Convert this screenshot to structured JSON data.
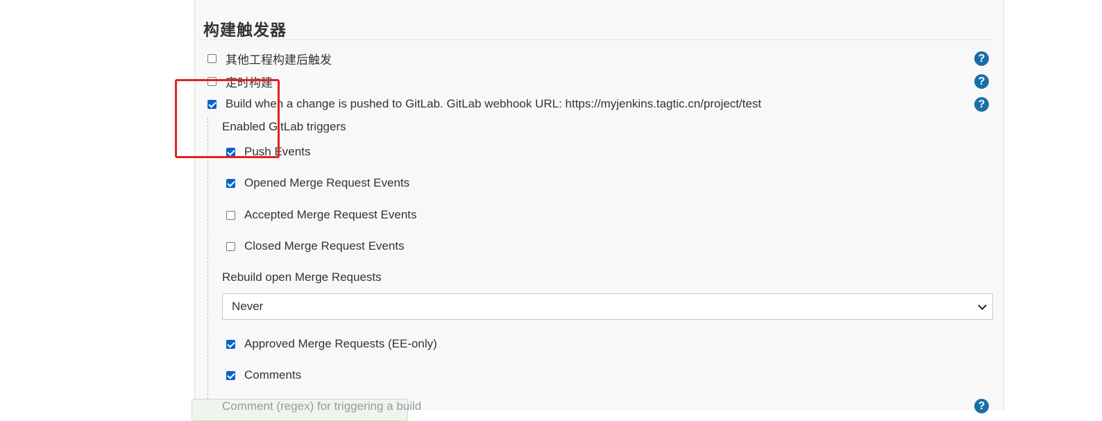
{
  "section": {
    "title": "构建触发器"
  },
  "triggers": [
    {
      "label": "其他工程构建后触发",
      "checked": false
    },
    {
      "label": "定时构建",
      "checked": false
    },
    {
      "label": "Build when a change is pushed to GitLab. GitLab webhook URL: https://myjenkins.tagtic.cn/project/test",
      "checked": true
    }
  ],
  "gitlab": {
    "enabled_triggers_label": "Enabled GitLab triggers",
    "events": [
      {
        "label": "Push Events",
        "checked": true
      },
      {
        "label": "Opened Merge Request Events",
        "checked": true
      },
      {
        "label": "Accepted Merge Request Events",
        "checked": false
      },
      {
        "label": "Closed Merge Request Events",
        "checked": false
      }
    ],
    "rebuild_label": "Rebuild open Merge Requests",
    "rebuild_select": {
      "value": "Never"
    },
    "extra_events": [
      {
        "label": "Approved Merge Requests (EE-only)",
        "checked": true
      },
      {
        "label": "Comments",
        "checked": true
      }
    ],
    "comment_regex_label_partial": "Comment (regex) for triggering a build"
  },
  "help_icon_glyph": "?",
  "colors": {
    "accent": "#0b63ce",
    "help": "#1a6ea8",
    "highlight": "#e0231d"
  }
}
